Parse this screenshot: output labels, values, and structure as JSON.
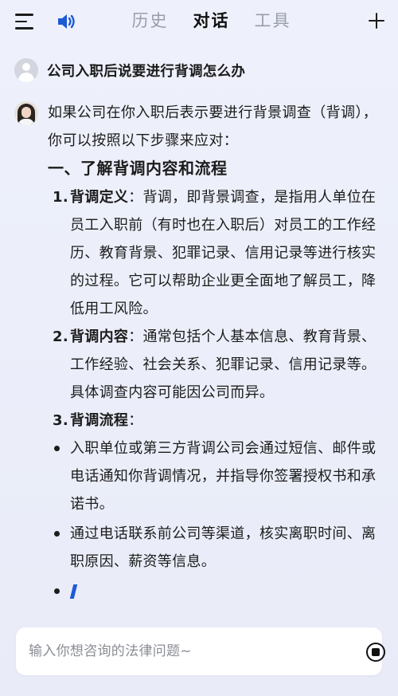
{
  "header": {
    "tabs": [
      {
        "label": "历史",
        "active": false
      },
      {
        "label": "对话",
        "active": true
      },
      {
        "label": "工具",
        "active": false
      }
    ],
    "icons": [
      "menu-icon",
      "speaker-icon",
      "plus-icon"
    ],
    "accent_color": "#1d5bd6"
  },
  "question": "公司入职后说要进行背调怎么办",
  "answer": {
    "intro": "如果公司在你入职后表示要进行背景调查（背调），你可以按照以下步骤来应对：",
    "section_title": "一、了解背调内容和流程",
    "items": [
      {
        "num": "1.",
        "title": "背调定义",
        "text": "：背调，即背景调查，是指用人单位在员工入职前（有时也在入职后）对员工的工作经历、教育背景、犯罪记录、信用记录等进行核实的过程。它可以帮助企业更全面地了解员工，降低用工风险。"
      },
      {
        "num": "2.",
        "title": "背调内容",
        "text": "：通常包括个人基本信息、教育背景、工作经验、社会关系、犯罪记录、信用记录等。具体调查内容可能因公司而异。"
      },
      {
        "num": "3.",
        "title": "背调流程",
        "text": "："
      }
    ],
    "bullets": [
      "入职单位或第三方背调公司会通过短信、邮件或电话通知你背调情况，并指导你签署授权书和承诺书。",
      "通过电话联系前公司等渠道，核实离职时间、离职原因、薪资等信息。"
    ]
  },
  "input": {
    "placeholder": "输入你想咨询的法律问题~",
    "value": ""
  }
}
